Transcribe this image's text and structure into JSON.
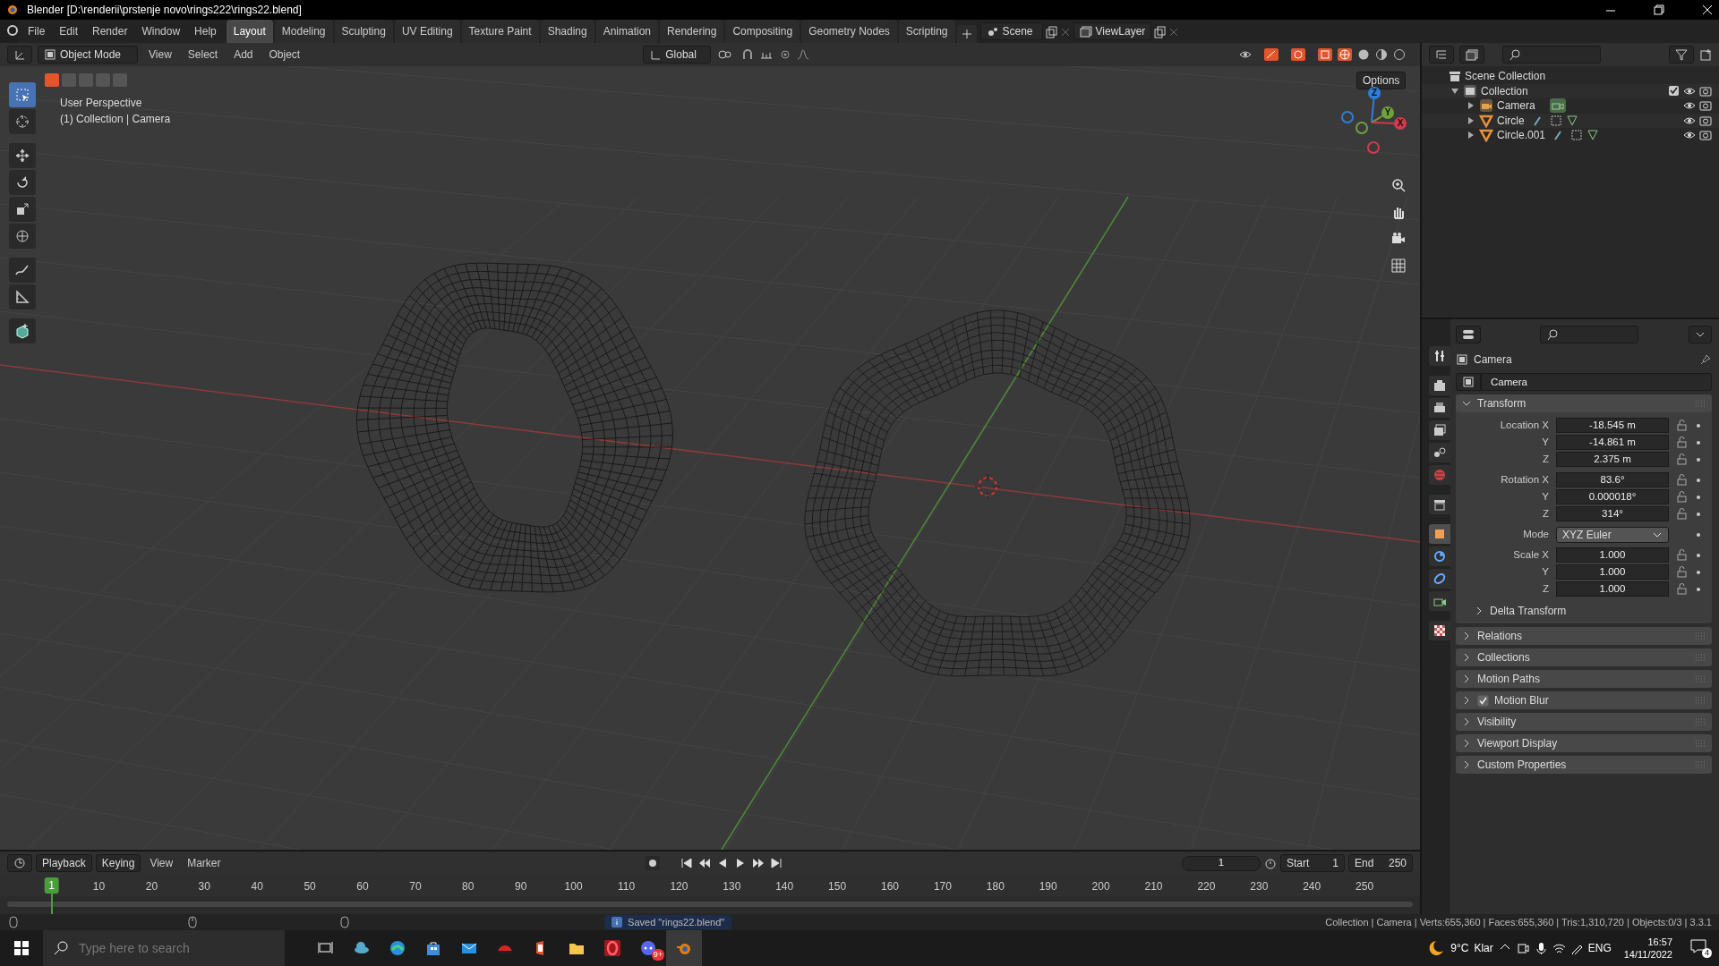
{
  "window": {
    "title": "Blender [D:\\renderii\\prstenje novo\\rings222\\rings22.blend]"
  },
  "menu": [
    "File",
    "Edit",
    "Render",
    "Window",
    "Help"
  ],
  "workspace_tabs": [
    {
      "label": "Layout",
      "selected": true
    },
    {
      "label": "Modeling",
      "selected": false
    },
    {
      "label": "Sculpting",
      "selected": false
    },
    {
      "label": "UV Editing",
      "selected": false
    },
    {
      "label": "Texture Paint",
      "selected": false
    },
    {
      "label": "Shading",
      "selected": false
    },
    {
      "label": "Animation",
      "selected": false
    },
    {
      "label": "Rendering",
      "selected": false
    },
    {
      "label": "Compositing",
      "selected": false
    },
    {
      "label": "Geometry Nodes",
      "selected": false
    },
    {
      "label": "Scripting",
      "selected": false
    }
  ],
  "scene": "Scene",
  "view_layer": "ViewLayer",
  "viewport_header": {
    "mode": "Object Mode",
    "menus": [
      "View",
      "Select",
      "Add",
      "Object"
    ],
    "orientation": "Global",
    "options": "Options"
  },
  "select_modes": [
    {
      "selected": true
    },
    {
      "selected": false
    },
    {
      "selected": false
    },
    {
      "selected": false
    },
    {
      "selected": false
    }
  ],
  "tools": [
    {
      "selected": true
    },
    {
      "selected": false
    },
    {
      "selected": false
    },
    {
      "selected": false
    },
    {
      "selected": false
    },
    {
      "selected": false
    },
    {
      "selected": false
    },
    {
      "selected": false
    },
    {
      "selected": false
    }
  ],
  "viewport_info": [
    "User Perspective",
    "(1) Collection | Camera"
  ],
  "gizmo": [
    {
      "label": "Z",
      "color": "#2f7ddb"
    },
    {
      "label": "Y",
      "color": "#6fa33a"
    },
    {
      "label": "X",
      "color": "#d13b4c"
    }
  ],
  "outliner": {
    "root": "Scene Collection",
    "items": [
      {
        "name": "Collection",
        "kind": "collection",
        "expanded": true,
        "checked": true,
        "children": [
          {
            "name": "Camera",
            "kind": "camera",
            "expanded": false
          },
          {
            "name": "Circle",
            "kind": "mesh",
            "expanded": false
          },
          {
            "name": "Circle.001",
            "kind": "mesh",
            "expanded": false
          }
        ]
      }
    ]
  },
  "properties": {
    "tabs": [
      {
        "selected": false
      },
      {
        "selected": false
      },
      {
        "selected": false
      },
      {
        "selected": false
      },
      {
        "selected": false
      },
      {
        "selected": false
      },
      {
        "selected": false
      },
      {
        "selected": true
      },
      {
        "selected": false
      },
      {
        "selected": false
      },
      {
        "selected": false
      },
      {
        "selected": false
      }
    ],
    "context": "Camera",
    "object_name": "Camera",
    "transform": {
      "title": "Transform",
      "expanded": true,
      "groups": [
        {
          "kind": "fields",
          "rows": [
            {
              "label": "Location X",
              "value": "-18.545 m"
            },
            {
              "label": "Y",
              "value": "-14.861 m"
            },
            {
              "label": "Z",
              "value": "2.375 m"
            }
          ]
        },
        {
          "kind": "fields",
          "rows": [
            {
              "label": "Rotation X",
              "value": "83.6°"
            },
            {
              "label": "Y",
              "value": "0.000018°"
            },
            {
              "label": "Z",
              "value": "314°"
            }
          ]
        },
        {
          "kind": "dropdown",
          "rows": [
            {
              "label": "Mode",
              "value": "XYZ Euler"
            }
          ]
        },
        {
          "kind": "fields",
          "rows": [
            {
              "label": "Scale X",
              "value": "1.000"
            },
            {
              "label": "Y",
              "value": "1.000"
            },
            {
              "label": "Z",
              "value": "1.000"
            }
          ]
        }
      ],
      "subpanel": {
        "title": "Delta Transform",
        "expanded": false
      }
    },
    "panels": [
      {
        "title": "Relations",
        "kind": "plain",
        "expanded": false
      },
      {
        "title": "Collections",
        "kind": "plain",
        "expanded": false
      },
      {
        "title": "Motion Paths",
        "kind": "plain",
        "expanded": false
      },
      {
        "title": "Motion Blur",
        "kind": "checkbox",
        "checked": true,
        "expanded": false
      },
      {
        "title": "Visibility",
        "kind": "plain",
        "expanded": false
      },
      {
        "title": "Viewport Display",
        "kind": "plain",
        "expanded": false
      },
      {
        "title": "Custom Properties",
        "kind": "plain",
        "expanded": false
      }
    ]
  },
  "timeline": {
    "menus": [
      "Playback",
      "Keying",
      "View",
      "Marker"
    ],
    "current_frame": "1",
    "start_label": "Start",
    "start": "1",
    "end_label": "End",
    "end": "250",
    "playhead": "1",
    "ruler": [
      "10",
      "20",
      "30",
      "40",
      "50",
      "60",
      "70",
      "80",
      "90",
      "100",
      "110",
      "120",
      "130",
      "140",
      "150",
      "160",
      "170",
      "180",
      "190",
      "200",
      "210",
      "220",
      "230",
      "240",
      "250"
    ]
  },
  "status_bar": {
    "message": "Saved \"rings22.blend\"",
    "stats": "Collection | Camera | Verts:655,360 | Faces:655,360 | Tris:1,310,720 | Objects:0/3 | 3.3.1"
  },
  "taskbar": {
    "search_placeholder": "Type here to search",
    "apps": [
      {
        "selected": false
      },
      {
        "selected": false
      },
      {
        "selected": false
      },
      {
        "selected": false
      },
      {
        "selected": false
      },
      {
        "selected": false
      },
      {
        "selected": false
      },
      {
        "selected": false
      },
      {
        "selected": false
      },
      {
        "selected": false
      },
      {
        "selected": true
      }
    ],
    "app_badge": "9+",
    "temperature": "9°C",
    "weather": "Klar",
    "language": "ENG",
    "time": "16:57",
    "date": "14/11/2022",
    "notifications": "4"
  }
}
